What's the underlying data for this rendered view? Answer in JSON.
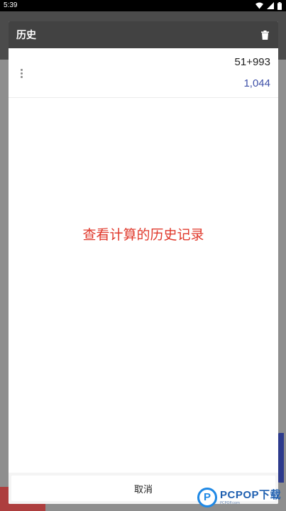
{
  "status_bar": {
    "time": "5:39",
    "icons": [
      "wifi-icon",
      "signal-icon",
      "battery-icon"
    ]
  },
  "dialog": {
    "title": "历史",
    "clear_icon": "trash-icon",
    "history": [
      {
        "expression": "51+993",
        "result": "1,044"
      }
    ],
    "caption": "查看计算的历史记录",
    "cancel_label": "取消"
  },
  "watermark": {
    "letter": "P",
    "brand": "PCPOP下载",
    "small": "PCPOP.com"
  },
  "colors": {
    "header_bg": "#424242",
    "result": "#3f51a8",
    "caption": "#e0382b",
    "watermark": "#1e88e5"
  }
}
